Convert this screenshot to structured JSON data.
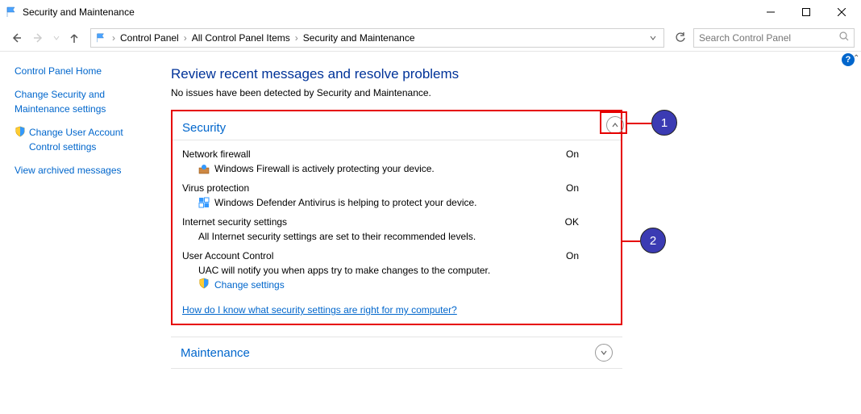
{
  "titlebar": {
    "title": "Security and Maintenance"
  },
  "breadcrumb": {
    "items": [
      "Control Panel",
      "All Control Panel Items",
      "Security and Maintenance"
    ]
  },
  "search": {
    "placeholder": "Search Control Panel"
  },
  "leftpanel": {
    "home": "Control Panel Home",
    "link1": "Change Security and Maintenance settings",
    "link2": "Change User Account Control settings",
    "link3": "View archived messages"
  },
  "main": {
    "heading": "Review recent messages and resolve problems",
    "subtext": "No issues have been detected by Security and Maintenance.",
    "security": {
      "title": "Security",
      "items": [
        {
          "label": "Network firewall",
          "status": "On",
          "desc": "Windows Firewall is actively protecting your device."
        },
        {
          "label": "Virus protection",
          "status": "On",
          "desc": "Windows Defender Antivirus is helping to protect your device."
        },
        {
          "label": "Internet security settings",
          "status": "OK",
          "desc": "All Internet security settings are set to their recommended levels."
        },
        {
          "label": "User Account Control",
          "status": "On",
          "desc": "UAC will notify you when apps try to make changes to the computer."
        }
      ],
      "change_link": "Change settings",
      "help_link": "How do I know what security settings are right for my computer?"
    },
    "maintenance": {
      "title": "Maintenance"
    }
  },
  "annotations": {
    "n1": "1",
    "n2": "2"
  }
}
